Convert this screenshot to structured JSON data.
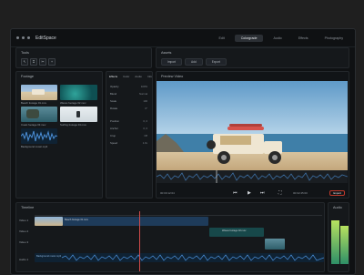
{
  "app": {
    "title": "EditSpace"
  },
  "nav": [
    "Edit",
    "Colorgrade",
    "Audio",
    "Effects",
    "Photography"
  ],
  "panels": {
    "tools": "Tools",
    "assets": "Assets",
    "footage": "Footage",
    "preview": "Preview Video",
    "timeline": "Timeline",
    "audio": "Audio"
  },
  "asset_buttons": [
    "Import",
    "Add",
    "Export"
  ],
  "footage_items": [
    {
      "label": "Beach footage 01.mov",
      "kind": "beach"
    },
    {
      "label": "Waves footage 02.mov",
      "kind": "waves"
    },
    {
      "label": "Coast footage 03.mov",
      "kind": "coast"
    },
    {
      "label": "Surfing footage 04.mov",
      "kind": "surf"
    },
    {
      "label": "Background music.mp3",
      "kind": "audio"
    }
  ],
  "properties": {
    "tabs": [
      "Effects",
      "Color",
      "Audio",
      "Info"
    ],
    "rows": [
      {
        "label": "Opacity",
        "value": "100%"
      },
      {
        "label": "Blend",
        "value": "Normal"
      },
      {
        "label": "Scale",
        "value": "100"
      },
      {
        "label": "Rotate",
        "value": "0°"
      },
      {
        "label": "Position",
        "value": "0, 0"
      },
      {
        "label": "Anchor",
        "value": "0, 0"
      },
      {
        "label": "Crop",
        "value": "Off"
      },
      {
        "label": "Speed",
        "value": "1.0x"
      }
    ]
  },
  "transport": {
    "timecode": "00:00:12:04",
    "duration": "00:02:45:00",
    "export": "Export"
  },
  "timeline": {
    "tracks": [
      "Video 1",
      "Video 2",
      "Video 3",
      "Audio 1"
    ],
    "clips": [
      {
        "label": "Beach footage 01.mov"
      },
      {
        "label": "Waves footage 02.mov"
      },
      {
        "label": "Coast footage 03.mov"
      },
      {
        "label": "Background music.mp3"
      }
    ]
  },
  "colors": {
    "accent": "#4b8fd8",
    "export": "#c0392b",
    "meter": "#5fd08a"
  }
}
